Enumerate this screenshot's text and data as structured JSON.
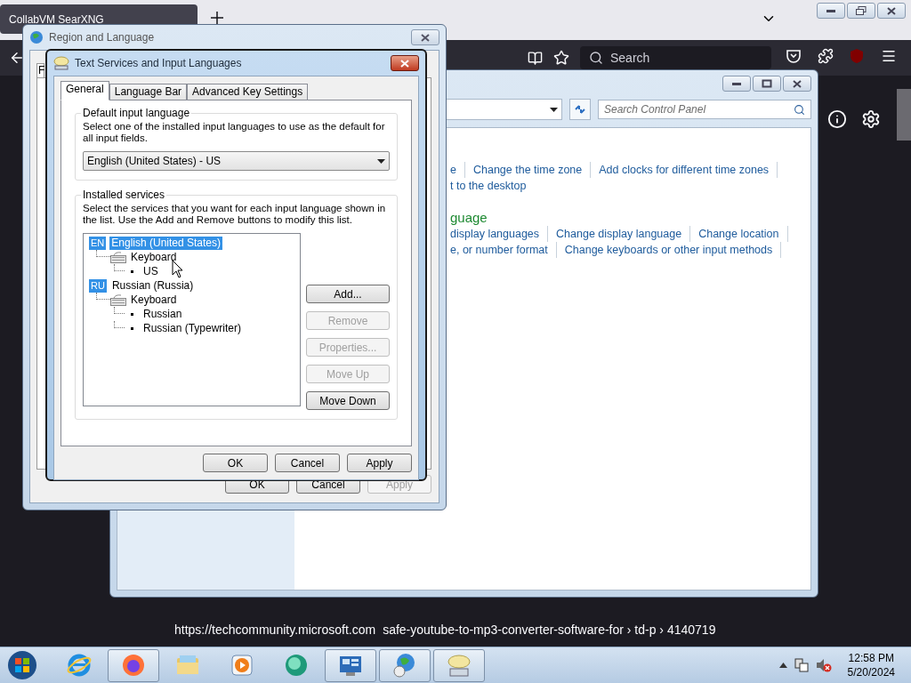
{
  "browser": {
    "tab": {
      "title": "CollabVM SearXNG",
      "selected": true
    },
    "search": {
      "placeholder": "Search"
    },
    "status": [
      "https://techcommunity.microsoft.com",
      "safe-youtube-to-mp3-converter-software-for › td-p › 4140719"
    ]
  },
  "control_panel": {
    "search": {
      "placeholder": "Search Control Panel"
    },
    "link_rows": [
      [
        "e",
        "Change the time zone",
        "Add clocks for different time zones"
      ],
      [
        "t to the desktop"
      ],
      [
        "display languages",
        "Change display language",
        "Change location"
      ],
      [
        "e, or number format",
        "Change keyboards or other input methods"
      ]
    ],
    "heading": "guage"
  },
  "region_dialog": {
    "title": "Region and Language",
    "tab_fragment": "F",
    "buttons": [
      {
        "label": "OK",
        "disabled": false
      },
      {
        "label": "Cancel",
        "disabled": false
      },
      {
        "label": "Apply",
        "disabled": true
      }
    ]
  },
  "text_services": {
    "title": "Text Services and Input Languages",
    "tabs": [
      {
        "label": "General",
        "selected": true
      },
      {
        "label": "Language Bar",
        "selected": false
      },
      {
        "label": "Advanced Key Settings",
        "selected": false
      }
    ],
    "default_group": {
      "title": "Default input language",
      "description": "Select one of the installed input languages to use as the default for all input fields.",
      "value": "English (United States) - US"
    },
    "services_group": {
      "title": "Installed services",
      "description": "Select the services that you want for each input language shown in the list. Use the Add and Remove buttons to modify this list.",
      "tree": [
        {
          "kind": "language",
          "code": "EN",
          "label": "English (United States)",
          "selected": true,
          "children": [
            {
              "kind": "category",
              "label": "Keyboard",
              "selected": false,
              "children": [
                {
                  "kind": "layout",
                  "label": "US",
                  "selected": false
                }
              ]
            }
          ]
        },
        {
          "kind": "language",
          "code": "RU",
          "label": "Russian (Russia)",
          "selected": false,
          "children": [
            {
              "kind": "category",
              "label": "Keyboard",
              "selected": false,
              "children": [
                {
                  "kind": "layout",
                  "label": "Russian",
                  "selected": false
                },
                {
                  "kind": "layout",
                  "label": "Russian (Typewriter)",
                  "selected": false
                }
              ]
            }
          ]
        }
      ],
      "buttons": [
        {
          "label": "Add...",
          "disabled": false
        },
        {
          "label": "Remove",
          "disabled": true
        },
        {
          "label": "Properties...",
          "disabled": true
        },
        {
          "label": "Move Up",
          "disabled": true
        },
        {
          "label": "Move Down",
          "disabled": false
        }
      ]
    },
    "buttons": [
      {
        "label": "OK",
        "disabled": false
      },
      {
        "label": "Cancel",
        "disabled": false
      },
      {
        "label": "Apply",
        "disabled": false
      }
    ]
  },
  "taskbar": {
    "apps": [
      {
        "kind": "ie",
        "active": false
      },
      {
        "kind": "firefox",
        "active": true
      },
      {
        "kind": "explorer",
        "active": false
      },
      {
        "kind": "media",
        "active": false
      },
      {
        "kind": "green",
        "active": false
      },
      {
        "kind": "control",
        "active": true
      },
      {
        "kind": "globe",
        "active": true
      },
      {
        "kind": "keyboard",
        "active": true
      }
    ],
    "time": "12:58 PM",
    "date": "5/20/2024"
  }
}
